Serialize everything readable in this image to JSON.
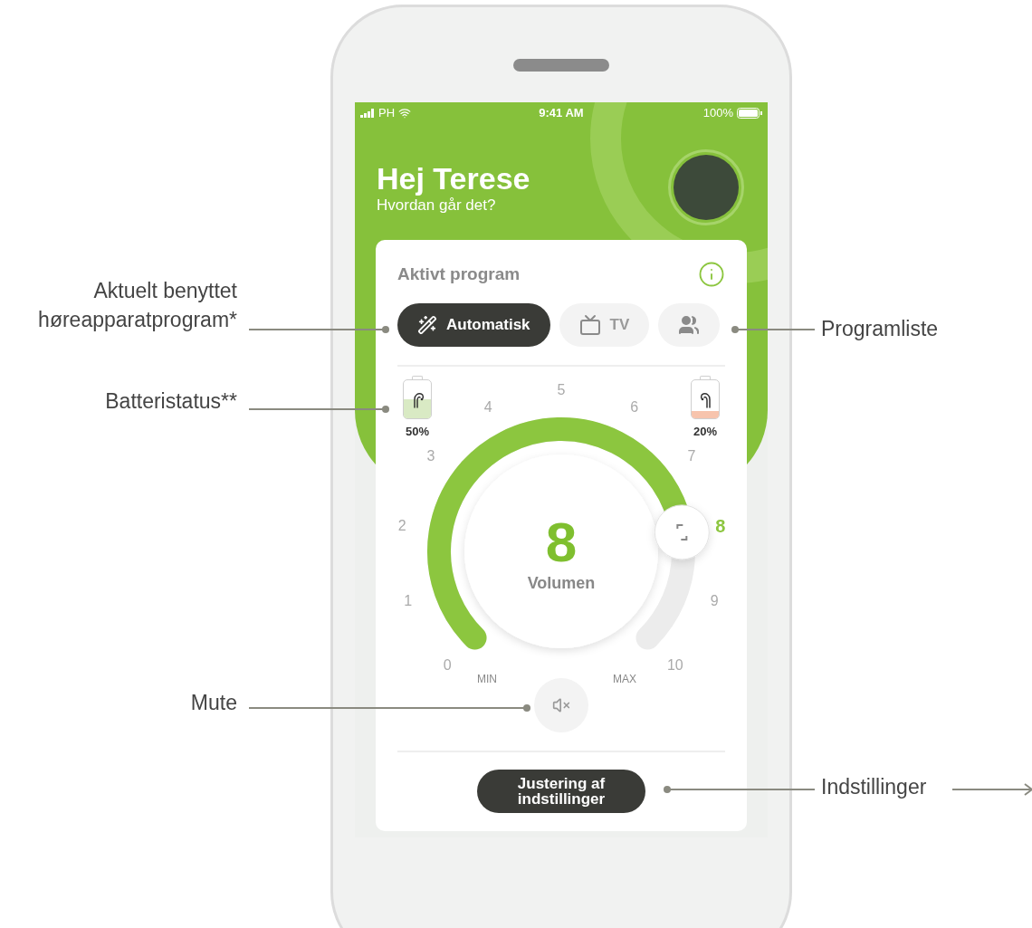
{
  "status_bar": {
    "carrier": "PH",
    "time": "9:41 AM",
    "battery": "100%"
  },
  "header": {
    "greeting": "Hej Terese",
    "subtitle": "Hvordan går det?"
  },
  "program_card": {
    "title": "Aktivt program",
    "programs": [
      {
        "kind": "automatic",
        "label": "Automatisk",
        "selected": true
      },
      {
        "kind": "tv",
        "label": "TV",
        "selected": false
      },
      {
        "kind": "group",
        "selected": false
      }
    ]
  },
  "batteries": [
    {
      "label": "50%",
      "level": 0.5,
      "color": "#d9eac4"
    },
    {
      "label": "20%",
      "level": 0.2,
      "color": "#f7c4ad"
    }
  ],
  "volume": {
    "value": "8",
    "label": "Volumen",
    "level": 0.8,
    "min_label": "MIN",
    "max_label": "MAX",
    "ticks": [
      {
        "label": "0",
        "selected": false
      },
      {
        "label": "1",
        "selected": false
      },
      {
        "label": "2",
        "selected": false
      },
      {
        "label": "3",
        "selected": false
      },
      {
        "label": "4",
        "selected": false
      },
      {
        "label": "5",
        "selected": false
      },
      {
        "label": "6",
        "selected": false
      },
      {
        "label": "7",
        "selected": false
      },
      {
        "label": "8",
        "selected": true
      },
      {
        "label": "9",
        "selected": false
      },
      {
        "label": "10",
        "selected": false
      }
    ]
  },
  "settings_button": {
    "label": "Justering af indstillinger"
  },
  "annotations": [
    {
      "text": "Aktuelt benyttet høreapparatprogram*"
    },
    {
      "text": "Batteristatus**"
    },
    {
      "text": "Mute"
    },
    {
      "text": "Programliste"
    },
    {
      "text": "Indstillinger"
    }
  ]
}
